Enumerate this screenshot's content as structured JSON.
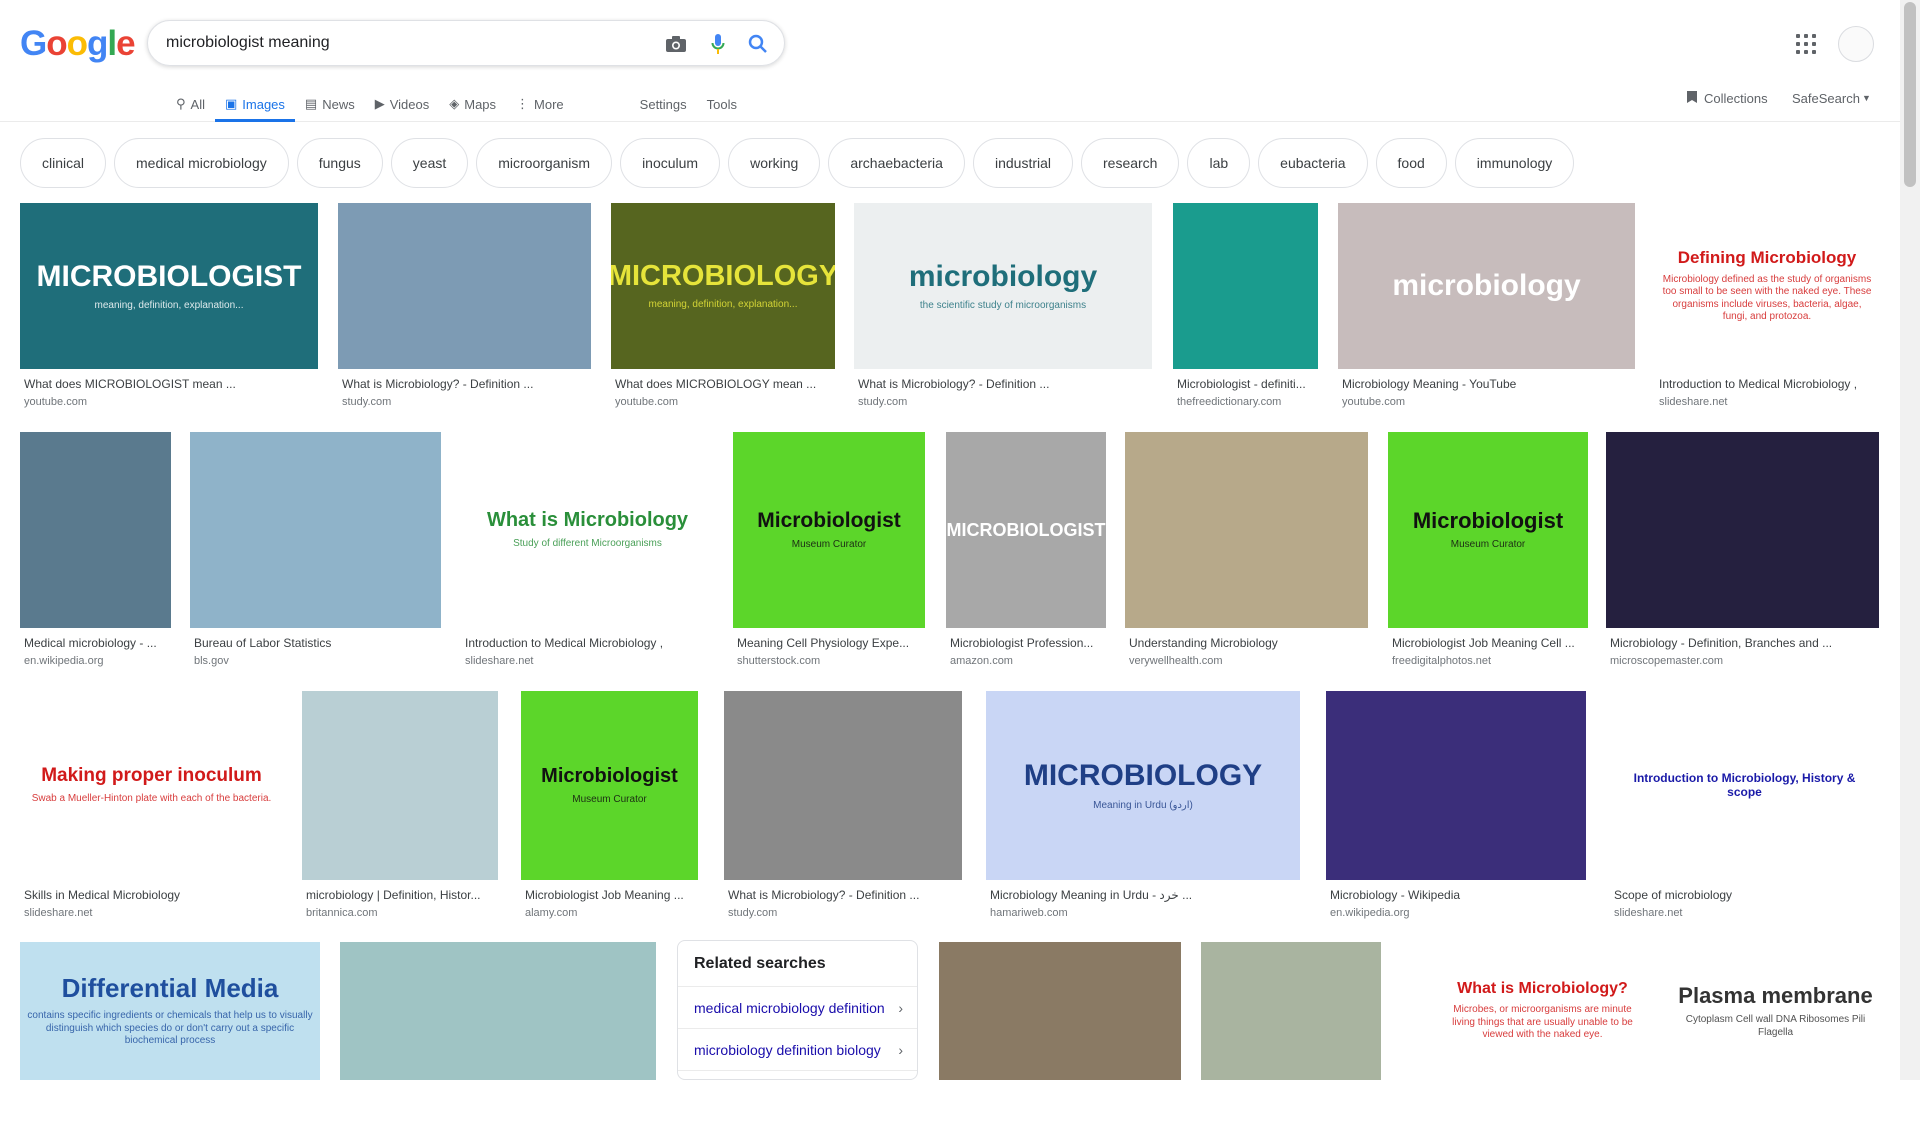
{
  "logo": "Google",
  "search": {
    "query": "microbiologist meaning"
  },
  "tabs": [
    {
      "label": "All",
      "icon": "search-icon"
    },
    {
      "label": "Images",
      "icon": "image-icon",
      "active": true
    },
    {
      "label": "News",
      "icon": "news-icon"
    },
    {
      "label": "Videos",
      "icon": "video-icon"
    },
    {
      "label": "Maps",
      "icon": "map-icon"
    },
    {
      "label": "More",
      "icon": "more-vert-icon"
    }
  ],
  "settings_label": "Settings",
  "tools_label": "Tools",
  "collections_label": "Collections",
  "safesearch_label": "SafeSearch",
  "chips": [
    "clinical",
    "medical microbiology",
    "fungus",
    "yeast",
    "microorganism",
    "inoculum",
    "working",
    "archaebacteria",
    "industrial",
    "research",
    "lab",
    "eubacteria",
    "food",
    "immunology"
  ],
  "results": [
    {
      "caption": "What does MICROBIOLOGIST mean ...",
      "source": "youtube.com",
      "img_text": "MICROBIOLOGIST",
      "img_sub": "meaning, definition, explanation...",
      "bg": "#1f6e7a",
      "fg": "#ffffff"
    },
    {
      "caption": "What is Microbiology? - Definition ...",
      "source": "study.com",
      "img_text": "",
      "img_sub": "",
      "bg": "#7d9bb4",
      "fg": "#ffffff"
    },
    {
      "caption": "What does MICROBIOLOGY mean ...",
      "source": "youtube.com",
      "img_text": "MICROBIOLOGY",
      "img_sub": "meaning, definition, explanation...",
      "bg": "#56651f",
      "fg": "#e6e43a"
    },
    {
      "caption": "What is Microbiology? - Definition ...",
      "source": "study.com",
      "img_text": "microbiology",
      "img_sub": "the scientific study of microorganisms",
      "bg": "#eceff0",
      "fg": "#1f6e7a"
    },
    {
      "caption": "Microbiologist - definiti...",
      "source": "thefreedictionary.com",
      "img_text": "",
      "img_sub": "",
      "bg": "#1a9c8e",
      "fg": "#ffffff"
    },
    {
      "caption": "Microbiology Meaning - YouTube",
      "source": "youtube.com",
      "img_text": "microbiology",
      "img_sub": "",
      "bg": "#c7bcbc",
      "fg": "#ffffff"
    },
    {
      "caption": "Introduction to Medical Microbiology ,",
      "source": "slideshare.net",
      "img_text": "Defining Microbiology",
      "img_sub": "Microbiology defined as the study of organisms too small to be seen with the naked eye. These organisms include viruses, bacteria, algae, fungi, and protozoa.",
      "bg": "#ffffff",
      "fg": "#d11a1a"
    },
    {
      "caption": "Medical microbiology - ...",
      "source": "en.wikipedia.org",
      "img_text": "",
      "img_sub": "",
      "bg": "#5a7a8e",
      "fg": "#ffffff"
    },
    {
      "caption": "Bureau of Labor Statistics",
      "source": "bls.gov",
      "img_text": "",
      "img_sub": "",
      "bg": "#8fb3c9",
      "fg": "#ffffff"
    },
    {
      "caption": "Introduction to Medical Microbiology ,",
      "source": "slideshare.net",
      "img_text": "What is Microbiology",
      "img_sub": "Study of different Microorganisms",
      "bg": "#ffffff",
      "fg": "#2a8f3a"
    },
    {
      "caption": "Meaning Cell Physiology Expe...",
      "source": "shutterstock.com",
      "img_text": "Microbiologist",
      "img_sub": "Museum Curator",
      "bg": "#5cd62a",
      "fg": "#111111"
    },
    {
      "caption": "Microbiologist Profession...",
      "source": "amazon.com",
      "img_text": "MICROBIOLOGIST",
      "img_sub": "",
      "bg": "#a8a8a8",
      "fg": "#ffffff"
    },
    {
      "caption": "Understanding Microbiology",
      "source": "verywellhealth.com",
      "img_text": "",
      "img_sub": "",
      "bg": "#b7a98a",
      "fg": "#ffffff"
    },
    {
      "caption": "Microbiologist Job Meaning Cell ...",
      "source": "freedigitalphotos.net",
      "img_text": "Microbiologist",
      "img_sub": "Museum Curator",
      "bg": "#5cd62a",
      "fg": "#111111"
    },
    {
      "caption": "Microbiology - Definition, Branches and ...",
      "source": "microscopemaster.com",
      "img_text": "",
      "img_sub": "",
      "bg": "#25203f",
      "fg": "#ffffff"
    },
    {
      "caption": "Skills in Medical Microbiology",
      "source": "slideshare.net",
      "img_text": "Making proper inoculum",
      "img_sub": "Swab a Mueller-Hinton plate with each of the bacteria.",
      "bg": "#ffffff",
      "fg": "#d11a1a"
    },
    {
      "caption": "microbiology | Definition, Histor...",
      "source": "britannica.com",
      "img_text": "",
      "img_sub": "",
      "bg": "#b9cfd4",
      "fg": "#ffffff"
    },
    {
      "caption": "Microbiologist Job Meaning ...",
      "source": "alamy.com",
      "img_text": "Microbiologist",
      "img_sub": "Museum Curator",
      "bg": "#5cd62a",
      "fg": "#111111"
    },
    {
      "caption": "What is Microbiology? - Definition ...",
      "source": "study.com",
      "img_text": "",
      "img_sub": "",
      "bg": "#8a8a8a",
      "fg": "#ffffff"
    },
    {
      "caption": "Microbiology Meaning in Urdu - خرد ...",
      "source": "hamariweb.com",
      "img_text": "MICROBIOLOGY",
      "img_sub": "Meaning in Urdu (اردو)",
      "bg": "#c9d6f5",
      "fg": "#1f3f86"
    },
    {
      "caption": "Microbiology - Wikipedia",
      "source": "en.wikipedia.org",
      "img_text": "",
      "img_sub": "",
      "bg": "#3b2e7a",
      "fg": "#ffffff"
    },
    {
      "caption": "Scope of microbiology",
      "source": "slideshare.net",
      "img_text": "Introduction to Microbiology, History & scope",
      "img_sub": "",
      "bg": "#ffffff",
      "fg": "#1a1aa8"
    },
    {
      "caption": "",
      "source": "",
      "img_text": "Differential Media",
      "img_sub": "contains specific ingredients or chemicals that help us to visually distinguish which species do or don't carry out a specific biochemical process",
      "bg": "#bfe0ef",
      "fg": "#1f4f9e"
    },
    {
      "caption": "",
      "source": "",
      "img_text": "",
      "img_sub": "",
      "bg": "#9fc4c4",
      "fg": "#ffffff"
    },
    {
      "caption": "",
      "source": "",
      "img_text": "",
      "img_sub": "",
      "bg": "#8a7a64",
      "fg": "#ffffff"
    },
    {
      "caption": "",
      "source": "",
      "img_text": "",
      "img_sub": "",
      "bg": "#a9b4a0",
      "fg": "#ffffff"
    },
    {
      "caption": "",
      "source": "",
      "img_text": "What is Microbiology?",
      "img_sub": "Microbes, or microorganisms are minute living things that are usually unable to be viewed with the naked eye.",
      "bg": "#ffffff",
      "fg": "#d11a1a"
    },
    {
      "caption": "",
      "source": "",
      "img_text": "Plasma membrane",
      "img_sub": "Cytoplasm  Cell wall  DNA  Ribosomes  Pili  Flagella",
      "bg": "#ffffff",
      "fg": "#333333"
    }
  ],
  "related": {
    "title": "Related searches",
    "items": [
      "medical microbiology definition",
      "microbiology definition biology"
    ]
  }
}
